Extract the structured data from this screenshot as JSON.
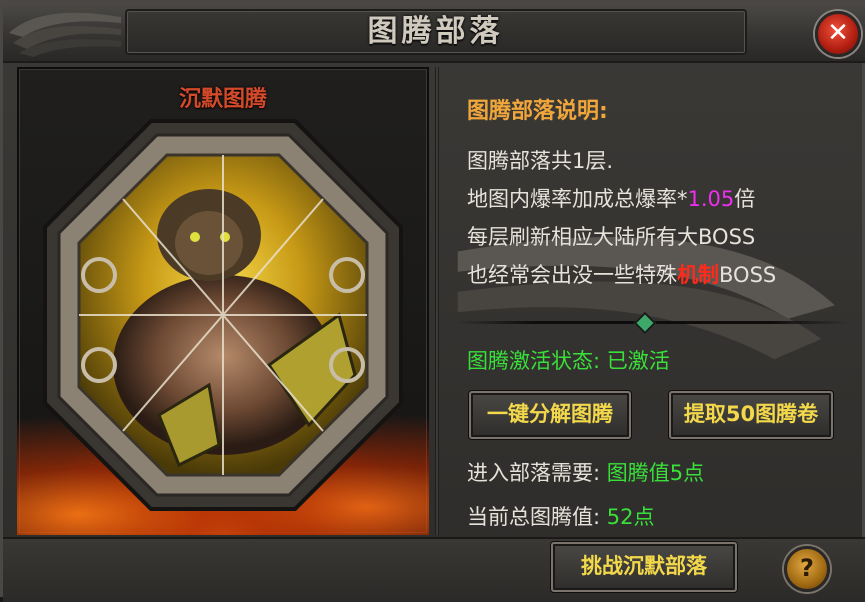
{
  "window": {
    "title": "图腾部落",
    "close_symbol": "✕",
    "help_symbol": "?"
  },
  "totem": {
    "name": "沉默图腾"
  },
  "description": {
    "title": "图腾部落说明:",
    "line1": "图腾部落共1层.",
    "line2_prefix": "地图内爆率加成总爆率*",
    "line2_value": "1.05",
    "line2_suffix": "倍",
    "line3": "每层刷新相应大陆所有大BOSS",
    "line4_prefix": "也经常会出没一些特殊",
    "line4_highlight": "机制",
    "line4_suffix": "BOSS"
  },
  "status": {
    "label": "图腾激活状态:",
    "value": "已激活"
  },
  "buttons": {
    "decompose": "一键分解图腾",
    "extract": "提取50图腾卷",
    "challenge": "挑战沉默部落"
  },
  "requirements": {
    "enter_label": "进入部落需要:",
    "enter_value": "图腾值5点",
    "current_label": "当前总图腾值:",
    "current_value": "52点"
  },
  "colors": {
    "accent_orange": "#f0a63a",
    "status_green": "#39e03a",
    "button_text": "#f2d84a",
    "highlight_magenta": "#f02cf0",
    "highlight_red": "#ff2a1a",
    "totem_name_red": "#d24a2a"
  },
  "icons": {
    "close": "close-icon",
    "help": "help-icon",
    "wings": "wing-ornament-icon"
  }
}
